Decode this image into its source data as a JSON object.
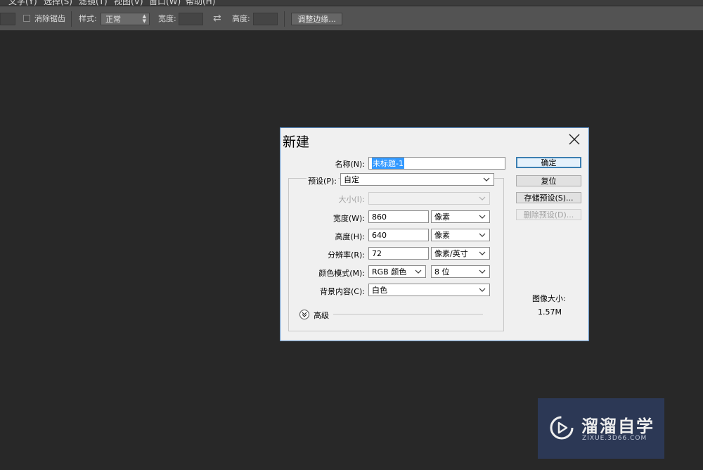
{
  "menubar": {
    "items": [
      "文字(Y)",
      "选择(S)",
      "滤镜(T)",
      "视图(V)",
      "窗口(W)",
      "帮助(H)"
    ]
  },
  "options_bar": {
    "antialias_label": "消除锯齿",
    "style_label": "样式:",
    "style_value": "正常",
    "width_label": "宽度:",
    "height_label": "高度:",
    "refine_edge_button": "调整边缘..."
  },
  "dialog": {
    "title": "新建",
    "name_label": "名称(N):",
    "name_value": "未标题-1",
    "preset_label": "预设(P):",
    "preset_value": "自定",
    "size_label": "大小(I):",
    "width_label": "宽度(W):",
    "width_value": "860",
    "width_unit": "像素",
    "height_label": "高度(H):",
    "height_value": "640",
    "height_unit": "像素",
    "resolution_label": "分辨率(R):",
    "resolution_value": "72",
    "resolution_unit": "像素/英寸",
    "color_mode_label": "颜色模式(M):",
    "color_mode_value": "RGB 颜色",
    "bit_depth_value": "8 位",
    "background_label": "背景内容(C):",
    "background_value": "白色",
    "advanced_label": "高级",
    "buttons": {
      "ok": "确定",
      "reset": "复位",
      "save_preset": "存储预设(S)...",
      "delete_preset": "删除预设(D)..."
    },
    "image_size_label": "图像大小:",
    "image_size_value": "1.57M"
  },
  "watermark": {
    "brand": "溜溜自学",
    "url": "ZIXUE.3D66.COM"
  },
  "colors": {
    "canvas_bg": "#282828",
    "options_bar_bg": "#535353",
    "dialog_bg": "#f0f0f0",
    "selection": "#3399ff",
    "default_button_border": "#3c7fb1",
    "watermark_bg": "#2d3a59"
  }
}
